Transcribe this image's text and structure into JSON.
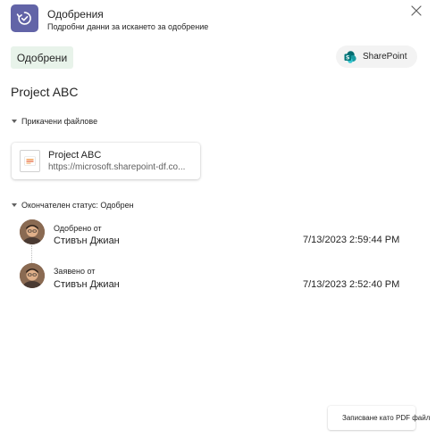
{
  "header": {
    "title": "Одобрения",
    "subtitle": "Подробни данни за искането за одобрение",
    "app_icon": "approvals-icon",
    "close_icon": "close-icon"
  },
  "status_chip": {
    "label": "Одобрени"
  },
  "sharepoint_button": {
    "label": "SharePoint",
    "icon": "sharepoint-logo-icon"
  },
  "request": {
    "title": "Project ABC"
  },
  "attachments": {
    "section_label": "Прикачени файлове",
    "files": [
      {
        "name": "Project ABC",
        "url": "https://microsoft.sharepoint-df.co...",
        "icon": "presentation-file-icon"
      }
    ]
  },
  "final_status": {
    "section_label": "Окончателен статус: Одобрен",
    "entries": [
      {
        "label": "Одобрено от",
        "name": "Стивън Джиан",
        "time": "7/13/2023 2:59:44 PM"
      },
      {
        "label": "Заявено от",
        "name": "Стивън Джиан",
        "time": "7/13/2023 2:52:40 PM"
      }
    ]
  },
  "footer": {
    "save_pdf_label": "Записване като PDF файл"
  },
  "colors": {
    "accent": "#6264a7",
    "approved_chip_bg": "#e8f3ea",
    "sharepoint_teal": "#038387"
  }
}
